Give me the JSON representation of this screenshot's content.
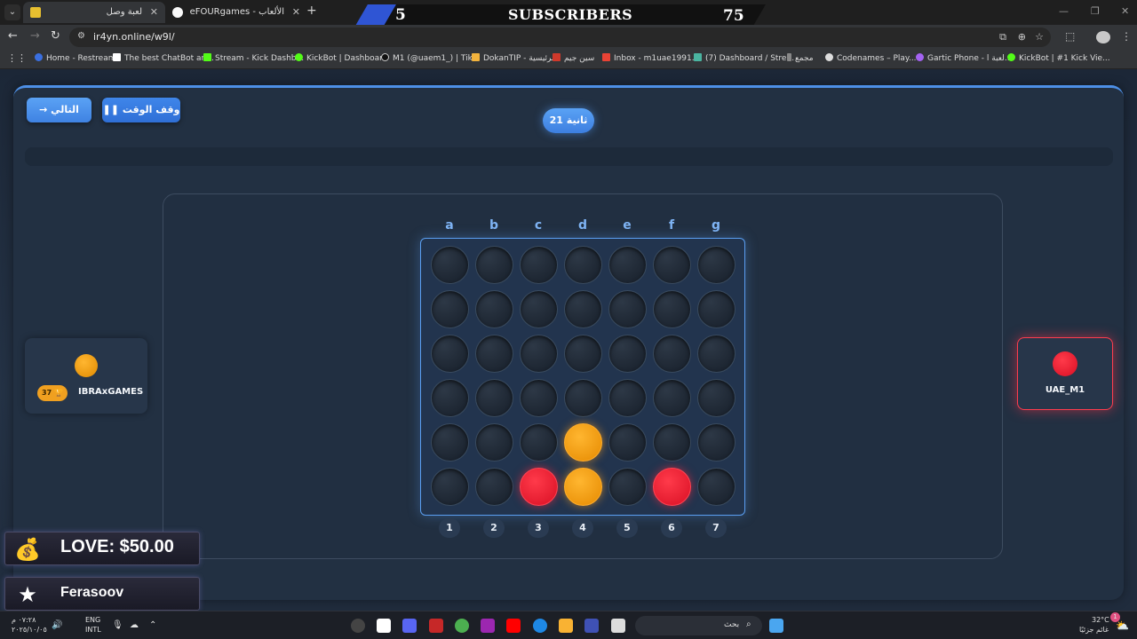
{
  "browser": {
    "tabs": [
      {
        "title": "لعبة وصل",
        "active": true
      },
      {
        "title": "eFOURgames - الألعاب",
        "active": false
      }
    ],
    "new_tab": "+",
    "url": "ir4yn.online/w9l/",
    "bookmarks": [
      "Home - Restream",
      "The best ChatBot an...",
      "Stream - Kick Dashb...",
      "KickBot | Dashboard",
      "M1 (@uaem1_) | Tik...",
      "DokanTIP - الرئيسية",
      "سين جيم",
      "Inbox - m1uae1991...",
      "(7) Dashboard / Stre...",
      "مجمع",
      "Codenames – Play...",
      "Gartic Phone - لعبة ا...",
      "KickBot | #1 Kick Vie..."
    ]
  },
  "subscriber_banner": {
    "current": "5",
    "label": "SUBSCRIBERS",
    "goal": "75"
  },
  "game": {
    "next_button": "التالي",
    "pause_button": "وقف الوقت",
    "timer": "21 ثانية",
    "columns": [
      "a",
      "b",
      "c",
      "d",
      "e",
      "f",
      "g"
    ],
    "column_numbers": [
      "1",
      "2",
      "3",
      "4",
      "5",
      "6",
      "7"
    ],
    "board": [
      [
        "",
        "",
        "",
        "",
        "",
        "",
        ""
      ],
      [
        "",
        "",
        "",
        "",
        "",
        "",
        ""
      ],
      [
        "",
        "",
        "",
        "",
        "",
        "",
        ""
      ],
      [
        "",
        "",
        "",
        "",
        "",
        "",
        ""
      ],
      [
        "",
        "",
        "",
        "yellow",
        "",
        "",
        ""
      ],
      [
        "",
        "",
        "red",
        "yellow",
        "",
        "red",
        ""
      ]
    ],
    "player_yellow": {
      "name": "IBRAxGAMES",
      "trophies": "37"
    },
    "player_red": {
      "name": "UAE_M1"
    }
  },
  "alerts": {
    "donation": "LOVE: $50.00",
    "follower": "Ferasoov"
  },
  "taskbar": {
    "time": "٠٧:٢٨ م",
    "date": "٢٠٢٥/١٠/٠٥",
    "lang_line1": "ENG",
    "lang_line2": "INTL",
    "search_placeholder": "بحث",
    "temperature": "32°C",
    "weather": "غائم جزئيًا",
    "notification_count": "1"
  },
  "colors": {
    "accent": "#3f82e2",
    "yellow_disc": "#f29a10",
    "red_disc": "#e01428"
  }
}
